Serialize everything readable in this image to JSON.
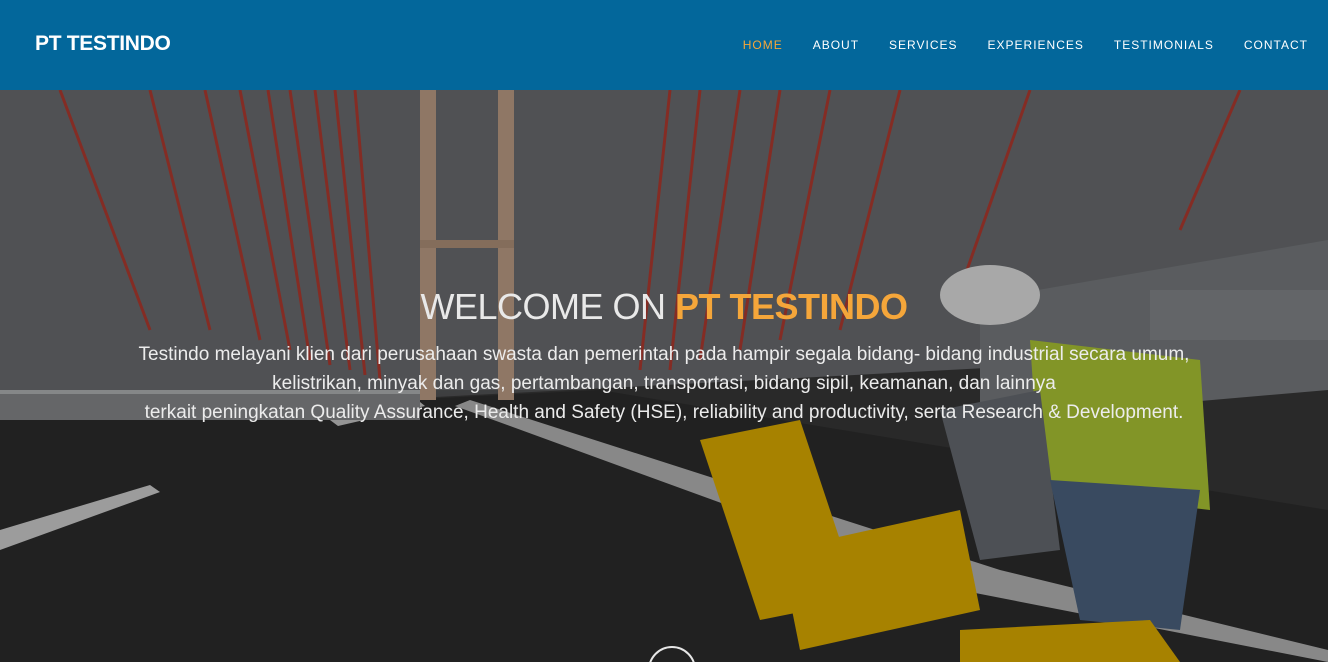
{
  "brand": "PT TESTINDO",
  "nav": {
    "items": [
      "HOME",
      "ABOUT",
      "SERVICES",
      "EXPERIENCES",
      "TESTIMONIALS",
      "CONTACT"
    ],
    "active": "HOME",
    "active_color": "#f5a63a"
  },
  "hero": {
    "title_prefix": "WELCOME ON",
    "title_highlight": "PT TESTINDO",
    "lines": [
      "Testindo melayani klien dari perusahaan swasta dan pemerintah pada hampir segala bidang- bidang industrial secara umum,",
      "kelistrikan, minyak dan gas, pertambangan, transportasi, bidang sipil, keamanan, dan lainnya",
      "terkait peningkatan Quality Assurance, Health and Safety (HSE), reliability and productivity, serta Research & Development."
    ],
    "scroll_icon": "scroll-down-circle-icon"
  },
  "colors": {
    "header_bg": "#03679b",
    "accent": "#f5a63a"
  }
}
